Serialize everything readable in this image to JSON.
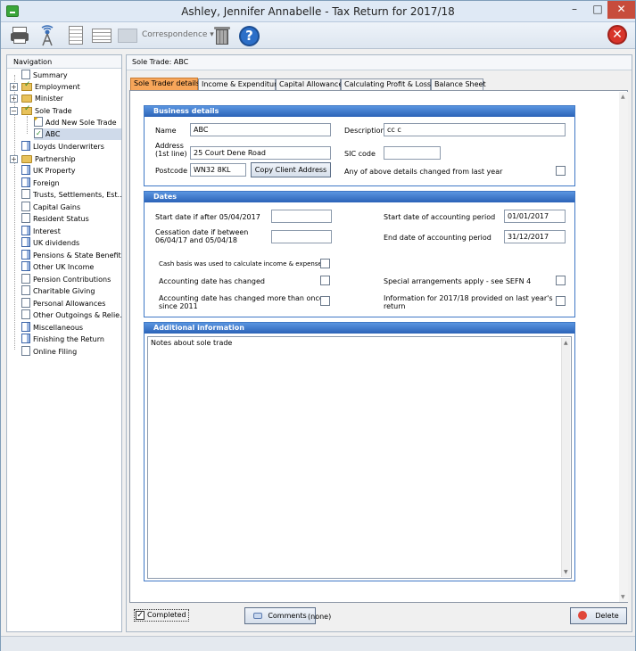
{
  "window": {
    "title": "Ashley, Jennifer Annabelle - Tax Return for 2017/18",
    "minimize": "–",
    "maximize": "□",
    "close": "✕"
  },
  "toolbar": {
    "correspondence_label": "Correspondence ▾",
    "help_glyph": "?",
    "exit_glyph": "✕"
  },
  "nav": {
    "header": "Navigation",
    "items": [
      {
        "label": "Summary"
      },
      {
        "label": "Employment"
      },
      {
        "label": "Minister"
      },
      {
        "label": "Sole Trade"
      },
      {
        "label": "Add New Sole Trade"
      },
      {
        "label": "ABC"
      },
      {
        "label": "Lloyds Underwriters"
      },
      {
        "label": "Partnership"
      },
      {
        "label": "UK Property"
      },
      {
        "label": "Foreign"
      },
      {
        "label": "Trusts, Settlements, Est..."
      },
      {
        "label": "Capital Gains"
      },
      {
        "label": "Resident Status"
      },
      {
        "label": "Interest"
      },
      {
        "label": "UK dividends"
      },
      {
        "label": "Pensions & State Benefits"
      },
      {
        "label": "Other UK Income"
      },
      {
        "label": "Pension Contributions"
      },
      {
        "label": "Charitable Giving"
      },
      {
        "label": "Personal Allowances"
      },
      {
        "label": "Other Outgoings & Relie..."
      },
      {
        "label": "Miscellaneous"
      },
      {
        "label": "Finishing the Return"
      },
      {
        "label": "Online Filing"
      }
    ]
  },
  "main": {
    "header": "Sole Trade: ABC",
    "tabs": [
      {
        "label": "Sole Trader details"
      },
      {
        "label": "Income & Expenditure"
      },
      {
        "label": "Capital Allowances"
      },
      {
        "label": "Calculating Profit & Losses"
      },
      {
        "label": "Balance Sheet"
      }
    ]
  },
  "business": {
    "title": "Business details",
    "name_label": "Name",
    "name_value": "ABC",
    "description_label": "Description",
    "description_value": "cc  c",
    "address_label_1": "Address",
    "address_label_2": "(1st line)",
    "address_value": "25 Court Dene Road",
    "sic_label": "SIC code",
    "sic_value": "",
    "postcode_label": "Postcode",
    "postcode_value": "WN32 8KL",
    "copy_button": "Copy Client Address",
    "changed_label": "Any of above details changed from last year"
  },
  "dates": {
    "title": "Dates",
    "start_label": "Start date if after 05/04/2017",
    "start_value": "",
    "cessation_label_1": "Cessation date if between",
    "cessation_label_2": "06/04/17 and 05/04/18",
    "cessation_value": "",
    "acc_start_label": "Start date of accounting period",
    "acc_start_value": "01/01/2017",
    "acc_end_label": "End date of accounting period",
    "acc_end_value": "31/12/2017",
    "cash_basis_label": "Cash basis was used to calculate income & expenses",
    "acc_changed_label": "Accounting date has changed",
    "special_label": "Special arrangements apply - see SEFN 4",
    "acc_changed_more_1": "Accounting date has changed more than once",
    "acc_changed_more_2": "since 2011",
    "info_provided_1": "Information for 2017/18 provided on last year's",
    "info_provided_2": "return"
  },
  "additional": {
    "title": "Additional information",
    "notes": "Notes about sole trade"
  },
  "footer": {
    "completed_label": "Completed",
    "completed_check": "✓",
    "comments_button": "Comments",
    "comments_status": "(none)",
    "delete_button": "Delete"
  }
}
